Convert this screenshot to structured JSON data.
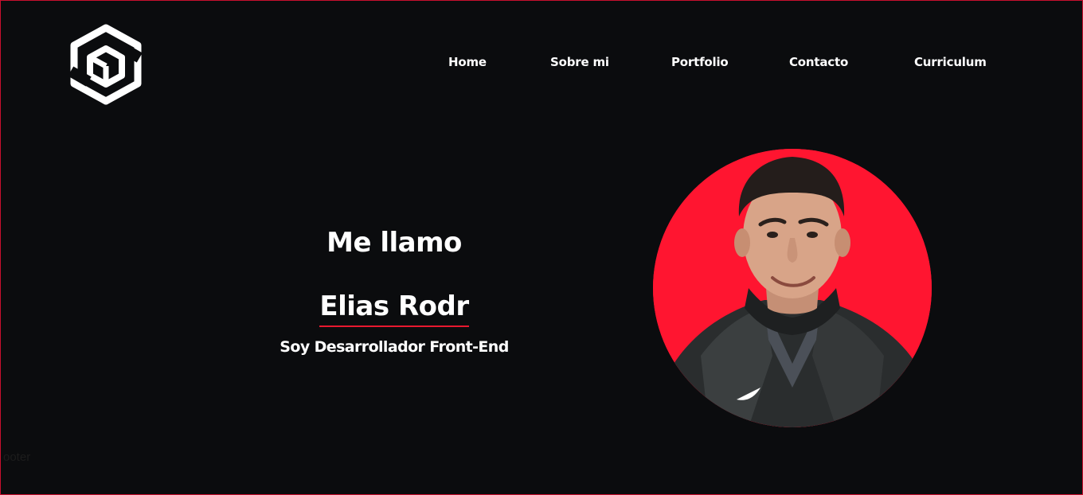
{
  "brand": {
    "logo_icon": "hexagon-cube-logo-icon"
  },
  "nav": {
    "items": [
      {
        "label": "Home"
      },
      {
        "label": "Sobre mi"
      },
      {
        "label": "Portfolio"
      },
      {
        "label": "Contacto"
      },
      {
        "label": "Curriculum"
      }
    ]
  },
  "hero": {
    "greeting": "Me llamo",
    "name": "Elias Rodr",
    "role": "Soy Desarrollador Front-End",
    "portrait_icon": "profile-photo"
  },
  "footer": {
    "text": "ooter"
  },
  "colors": {
    "background": "#0b0c0e",
    "accent": "#ff1530",
    "text": "#ffffff"
  }
}
